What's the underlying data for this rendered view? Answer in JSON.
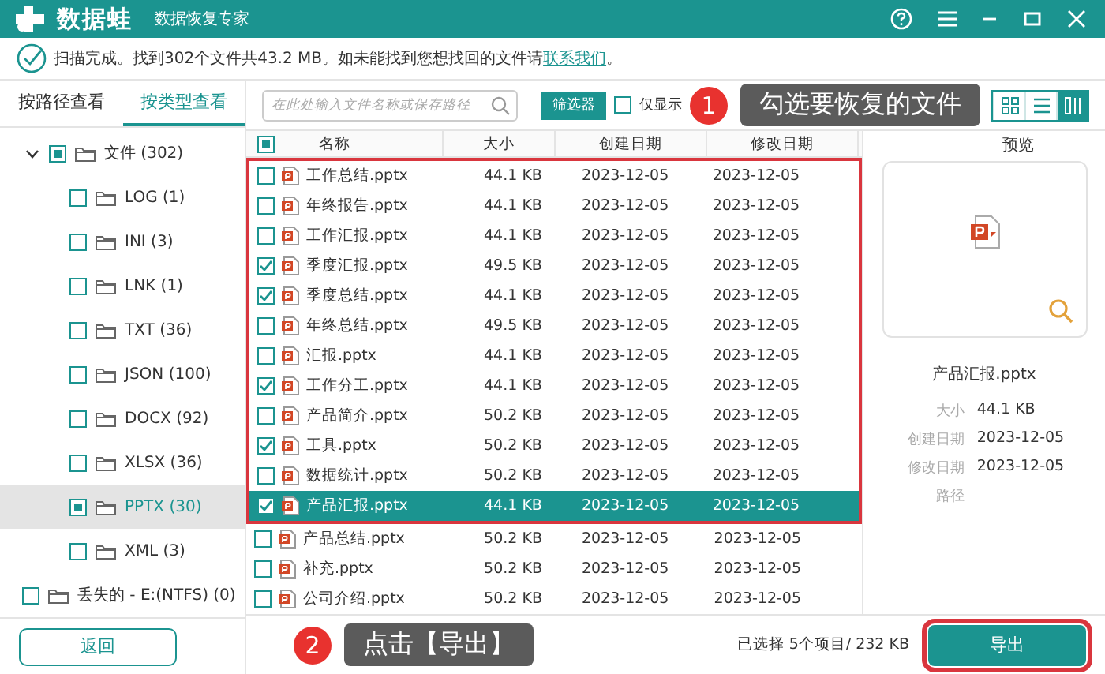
{
  "window": {
    "app_name": "数据蛙",
    "subtitle": "数据恢复专家"
  },
  "scan_notice": {
    "text": "扫描完成。找到302个文件共43.2 MB。如未能找到您想找回的文件请",
    "link": "联系我们",
    "tail": "。"
  },
  "view_tabs": [
    {
      "label": "按路径查看",
      "selected": false
    },
    {
      "label": "按类型查看",
      "selected": true
    }
  ],
  "tree": [
    {
      "label": "文件 (302)",
      "expanded": true,
      "partial": true,
      "selected": false,
      "children": [
        {
          "label": "LOG (1)",
          "partial": false,
          "selected": false
        },
        {
          "label": "INI (3)",
          "partial": false,
          "selected": false
        },
        {
          "label": "LNK (1)",
          "partial": false,
          "selected": false
        },
        {
          "label": "TXT (36)",
          "partial": false,
          "selected": false
        },
        {
          "label": "JSON (100)",
          "partial": false,
          "selected": false
        },
        {
          "label": "DOCX (92)",
          "partial": false,
          "selected": false
        },
        {
          "label": "XLSX (36)",
          "partial": false,
          "selected": false
        },
        {
          "label": "PPTX (30)",
          "partial": true,
          "selected": true
        },
        {
          "label": "XML (3)",
          "partial": false,
          "selected": false
        }
      ]
    },
    {
      "label": "丢失的 - E:(NTFS) (0)",
      "partial": false,
      "selected": false
    }
  ],
  "back_button": "返回",
  "toolbar": {
    "search": {
      "placeholder": "在此处输入文件名称或保存路径"
    },
    "filter_button": "筛选器",
    "only_selected": {
      "label": "仅显示",
      "checked": false
    },
    "view_modes": [
      {
        "selected": false
      },
      {
        "selected": false
      },
      {
        "selected": true
      }
    ]
  },
  "callouts": [
    {
      "number": "1",
      "text": "勾选要恢复的文件"
    },
    {
      "number": "2",
      "text": "点击【导出】"
    }
  ],
  "table": {
    "select_all": {
      "partial": true
    },
    "columns": [
      "名称",
      "大小",
      "创建日期",
      "修改日期"
    ],
    "rows": [
      {
        "name": "工作总结.pptx",
        "size": "44.1 KB",
        "created": "2023-12-05",
        "modified": "2023-12-05",
        "checked": false,
        "selected": false,
        "highlighted": true
      },
      {
        "name": "年终报告.pptx",
        "size": "44.1 KB",
        "created": "2023-12-05",
        "modified": "2023-12-05",
        "checked": false,
        "selected": false,
        "highlighted": true
      },
      {
        "name": "工作汇报.pptx",
        "size": "44.1 KB",
        "created": "2023-12-05",
        "modified": "2023-12-05",
        "checked": false,
        "selected": false,
        "highlighted": true
      },
      {
        "name": "季度汇报.pptx",
        "size": "49.5 KB",
        "created": "2023-12-05",
        "modified": "2023-12-05",
        "checked": true,
        "selected": false,
        "highlighted": true
      },
      {
        "name": "季度总结.pptx",
        "size": "44.1 KB",
        "created": "2023-12-05",
        "modified": "2023-12-05",
        "checked": true,
        "selected": false,
        "highlighted": true
      },
      {
        "name": "年终总结.pptx",
        "size": "49.5 KB",
        "created": "2023-12-05",
        "modified": "2023-12-05",
        "checked": false,
        "selected": false,
        "highlighted": true
      },
      {
        "name": "汇报.pptx",
        "size": "44.1 KB",
        "created": "2023-12-05",
        "modified": "2023-12-05",
        "checked": false,
        "selected": false,
        "highlighted": true
      },
      {
        "name": "工作分工.pptx",
        "size": "44.1 KB",
        "created": "2023-12-05",
        "modified": "2023-12-05",
        "checked": true,
        "selected": false,
        "highlighted": true
      },
      {
        "name": "产品简介.pptx",
        "size": "50.2 KB",
        "created": "2023-12-05",
        "modified": "2023-12-05",
        "checked": false,
        "selected": false,
        "highlighted": true
      },
      {
        "name": "工具.pptx",
        "size": "50.2 KB",
        "created": "2023-12-05",
        "modified": "2023-12-05",
        "checked": true,
        "selected": false,
        "highlighted": true
      },
      {
        "name": "数据统计.pptx",
        "size": "50.2 KB",
        "created": "2023-12-05",
        "modified": "2023-12-05",
        "checked": false,
        "selected": false,
        "highlighted": true
      },
      {
        "name": "产品汇报.pptx",
        "size": "44.1 KB",
        "created": "2023-12-05",
        "modified": "2023-12-05",
        "checked": true,
        "selected": true,
        "highlighted": true
      },
      {
        "name": "产品总结.pptx",
        "size": "50.2 KB",
        "created": "2023-12-05",
        "modified": "2023-12-05",
        "checked": false,
        "selected": false,
        "highlighted": false
      },
      {
        "name": "补充.pptx",
        "size": "50.2 KB",
        "created": "2023-12-05",
        "modified": "2023-12-05",
        "checked": false,
        "selected": false,
        "highlighted": false
      },
      {
        "name": "公司介绍.pptx",
        "size": "50.2 KB",
        "created": "2023-12-05",
        "modified": "2023-12-05",
        "checked": false,
        "selected": false,
        "highlighted": false
      }
    ]
  },
  "preview": {
    "title": "预览",
    "file_name": "产品汇报.pptx",
    "details": [
      {
        "label": "大小",
        "value": "44.1 KB"
      },
      {
        "label": "创建日期",
        "value": "2023-12-05"
      },
      {
        "label": "修改日期",
        "value": "2023-12-05"
      },
      {
        "label": "路径"
      }
    ]
  },
  "status": "已选择 5个项目/ 232 KB",
  "export_button": {
    "label": "导出",
    "highlighted": true
  }
}
